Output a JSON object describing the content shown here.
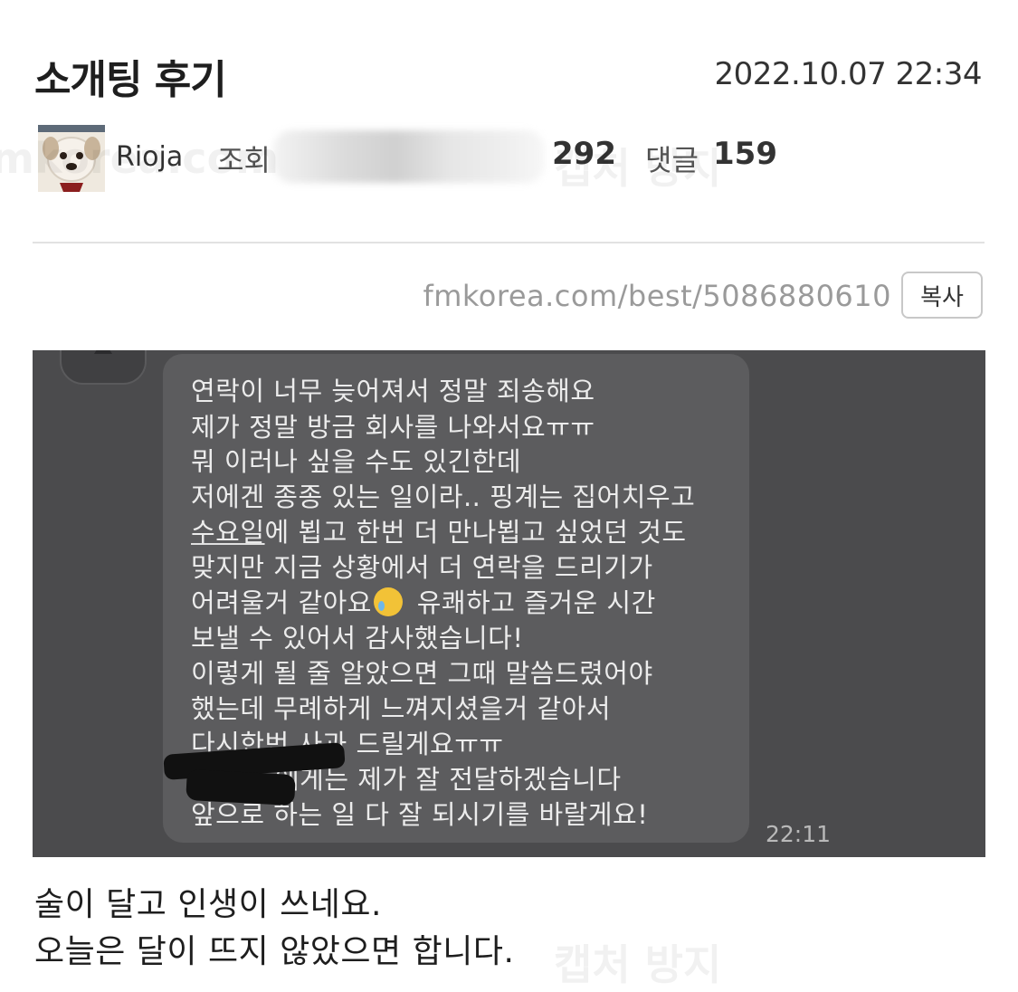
{
  "post": {
    "title": "소개팅 후기",
    "date": "2022.10.07 22:34",
    "author": "Rioja",
    "views_label": "조회",
    "recommend_count": "292",
    "comments_label": "댓글",
    "comments_count": "159",
    "url": "fmkorea.com/best/5086880610",
    "copy_label": "복사"
  },
  "chat": {
    "lines": [
      "연락이 너무 늦어져서 정말 죄송해요",
      "제가 정말 방금 회사를 나와서요ㅠㅠ",
      "뭐 이러나 싶을 수도 있긴한데",
      "저에겐 종종 있는 일이라.. 핑계는 집어치우고",
      "에 뵙고 한번 더 만나뵙고 싶었던 것도",
      "맞지만 지금 상황에서 더 연락을 드리기가",
      "어려울거 같아요",
      "유쾌하고 즐거운 시간",
      "보낼 수 있어서 감사했습니다!",
      "이렇게 될 줄 알았으면 그때 말씀드렸어야",
      "했는데 무례하게 느껴지셨을거 같아서",
      "다시한번 사과 드릴게요ㅠㅠ",
      "에게는 제가 잘 전달하겠습니다",
      "앞으로 하는 일 다 잘 되시기를 바랄게요!"
    ],
    "underlined_word": "수요일",
    "time": "22:11"
  },
  "body": {
    "lines": [
      "술이 달고 인생이 쓰네요.",
      "오늘은 달이 뜨지 않았으면 합니다."
    ]
  },
  "watermark": {
    "site": "fmkorea.com",
    "text": "캡처 방지"
  },
  "icons": {
    "avatar": "dog-avatar-icon",
    "emoji": "crying-face-emoji-icon"
  },
  "colors": {
    "chat_background": "#4b4b4d",
    "bubble": "#5c5c5e",
    "url_text": "#9a9a9a"
  }
}
